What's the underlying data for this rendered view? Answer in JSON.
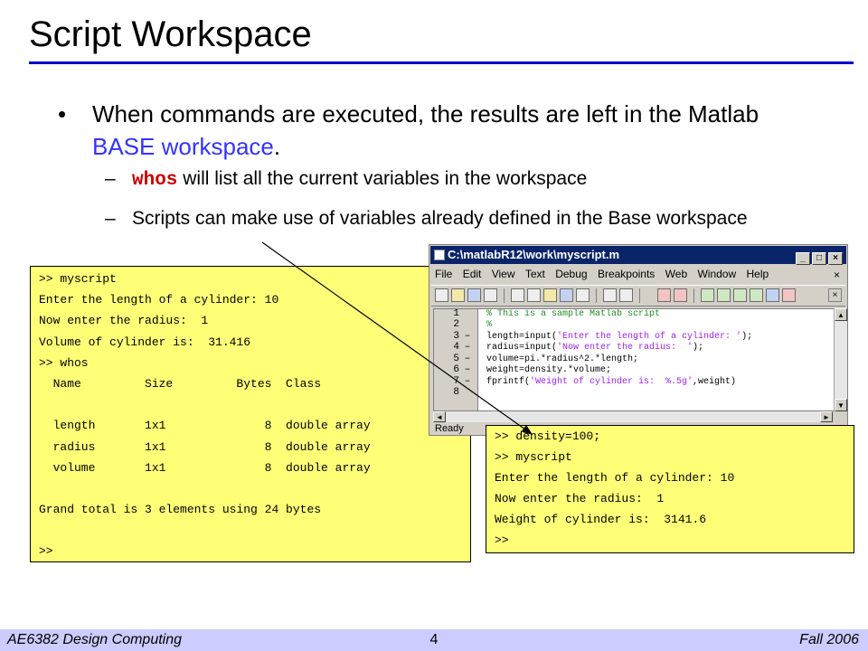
{
  "slide": {
    "title": "Script Workspace",
    "bullet1": {
      "prefix": "When commands are executed, the results are left in the Matlab ",
      "highlight": "BASE workspace",
      "suffix": "."
    },
    "bullet2": {
      "command": "whos",
      "text": " will list all the current variables in the workspace"
    },
    "bullet3": {
      "text": "Scripts can make use of variables already defined in the Base workspace"
    }
  },
  "console_left": {
    "lines": [
      ">> myscript",
      "Enter the length of a cylinder: 10",
      "Now enter the radius:  1",
      "Volume of cylinder is:  31.416",
      ">> whos",
      "  Name         Size         Bytes  Class",
      "",
      "  length       1x1              8  double array",
      "  radius       1x1              8  double array",
      "  volume       1x1              8  double array",
      "",
      "Grand total is 3 elements using 24 bytes",
      "",
      ">>"
    ]
  },
  "editor": {
    "title": "C:\\matlabR12\\work\\myscript.m",
    "menu": [
      "File",
      "Edit",
      "View",
      "Text",
      "Debug",
      "Breakpoints",
      "Web",
      "Window",
      "Help"
    ],
    "line_numbers": [
      "1",
      "2",
      "3",
      "4",
      "5",
      "6",
      "7",
      "8"
    ],
    "markers": [
      "",
      "",
      "–",
      "–",
      "–",
      "–",
      "–",
      ""
    ],
    "code": [
      "% This is a sample Matlab script",
      "%",
      "length=input('Enter the length of a cylinder: ');",
      "radius=input('Now enter the radius:  ');",
      "volume=pi.*radius^2.*length;",
      "weight=density.*volume;",
      "fprintf('Weight of cylinder is:  %.5g',weight)",
      ""
    ],
    "status": "Ready"
  },
  "console_right": {
    "lines": [
      ">> density=100;",
      ">> myscript",
      "Enter the length of a cylinder: 10",
      "Now enter the radius:  1",
      "Weight of cylinder is:  3141.6",
      ">>"
    ]
  },
  "footer": {
    "left": "AE6382 Design Computing",
    "center": "4",
    "right": "Fall 2006"
  },
  "colors": {
    "title_rule": "#0000cc",
    "highlight": "#3333ff",
    "console_bg": "#ffff77",
    "footer_bg": "#ccccff",
    "command_color": "#cc0000"
  }
}
